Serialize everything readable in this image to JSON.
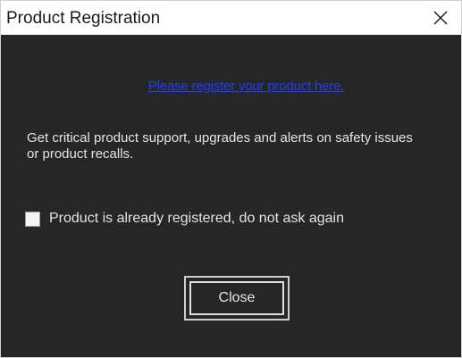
{
  "window": {
    "title": "Product Registration"
  },
  "dialog": {
    "link_text": "Please register your product here.",
    "description": "Get critical product support, upgrades and alerts on safety issues or product recalls.",
    "checkbox_label": "Product is already registered, do not ask again",
    "checkbox_checked": false,
    "close_button_label": "Close"
  },
  "colors": {
    "background": "#262626",
    "link": "#1f3cff",
    "text": "#e4e4e4"
  },
  "icons": {
    "titlebar_close": "close-icon"
  }
}
